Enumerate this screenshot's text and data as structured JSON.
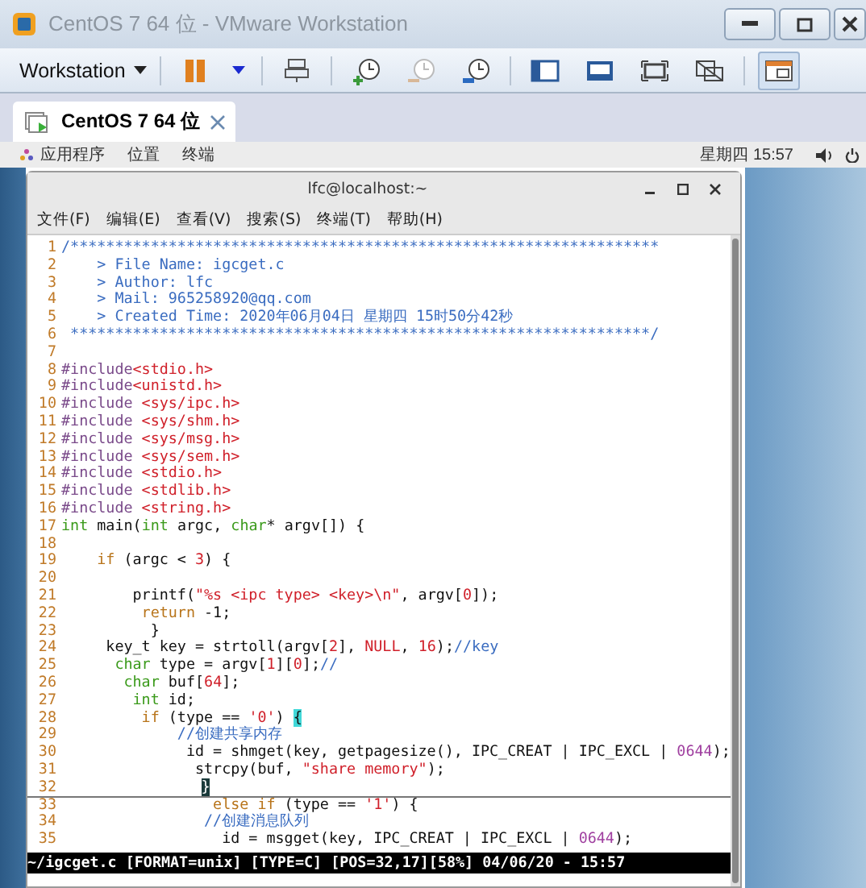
{
  "window": {
    "title": "CentOS 7 64 位 - VMware Workstation"
  },
  "toolbar": {
    "menu_label": "Workstation"
  },
  "tabs": [
    {
      "label": "CentOS 7 64 位",
      "selected": true
    }
  ],
  "guest_top_bar": {
    "menus": [
      "应用程序",
      "位置",
      "终端"
    ],
    "clock": "星期四 15:57"
  },
  "terminal": {
    "title": "lfc@localhost:~",
    "menus": [
      "文件(F)",
      "编辑(E)",
      "查看(V)",
      "搜索(S)",
      "终端(T)",
      "帮助(H)"
    ],
    "lines": [
      {
        "number": "1",
        "current": false,
        "tokens": [
          {
            "kind": "comment",
            "text": "/******************************************************************"
          }
        ]
      },
      {
        "number": "2",
        "current": false,
        "tokens": [
          {
            "kind": "comment",
            "text": "    > File Name: igcget.c"
          }
        ]
      },
      {
        "number": "3",
        "current": false,
        "tokens": [
          {
            "kind": "comment",
            "text": "    > Author: lfc"
          }
        ]
      },
      {
        "number": "4",
        "current": false,
        "tokens": [
          {
            "kind": "comment",
            "text": "    > Mail: 965258920@qq.com"
          }
        ]
      },
      {
        "number": "5",
        "current": false,
        "tokens": [
          {
            "kind": "comment",
            "text": "    > Created Time: 2020年06月04日 星期四 15时50分42秒"
          }
        ]
      },
      {
        "number": "6",
        "current": false,
        "tokens": [
          {
            "kind": "comment",
            "text": " *****************************************************************/"
          }
        ]
      },
      {
        "number": "7",
        "current": false
      },
      {
        "number": "8",
        "current": false,
        "tokens": [
          {
            "kind": "preproc",
            "text": "#include"
          },
          {
            "kind": "header",
            "text": "<stdio.h>"
          }
        ]
      },
      {
        "number": "9",
        "current": false,
        "tokens": [
          {
            "kind": "preproc",
            "text": "#include"
          },
          {
            "kind": "header",
            "text": "<unistd.h>"
          }
        ]
      },
      {
        "number": "10",
        "current": false,
        "tokens": [
          {
            "kind": "preproc",
            "text": "#include "
          },
          {
            "kind": "header",
            "text": "<sys/ipc.h>"
          }
        ]
      },
      {
        "number": "11",
        "current": false,
        "tokens": [
          {
            "kind": "preproc",
            "text": "#include "
          },
          {
            "kind": "header",
            "text": "<sys/shm.h>"
          }
        ]
      },
      {
        "number": "12",
        "current": false,
        "tokens": [
          {
            "kind": "preproc",
            "text": "#include "
          },
          {
            "kind": "header",
            "text": "<sys/msg.h>"
          }
        ]
      },
      {
        "number": "13",
        "current": false,
        "tokens": [
          {
            "kind": "preproc",
            "text": "#include "
          },
          {
            "kind": "header",
            "text": "<sys/sem.h>"
          }
        ]
      },
      {
        "number": "14",
        "current": false,
        "tokens": [
          {
            "kind": "preproc",
            "text": "#include "
          },
          {
            "kind": "header",
            "text": "<stdio.h>"
          }
        ]
      },
      {
        "number": "15",
        "current": false,
        "tokens": [
          {
            "kind": "preproc",
            "text": "#include "
          },
          {
            "kind": "header",
            "text": "<stdlib.h>"
          }
        ]
      },
      {
        "number": "16",
        "current": false,
        "tokens": [
          {
            "kind": "preproc",
            "text": "#include "
          },
          {
            "kind": "header",
            "text": "<string.h>"
          }
        ]
      },
      {
        "number": "17",
        "current": false,
        "tokens": [
          {
            "kind": "type",
            "text": "int"
          },
          {
            "kind": "plain",
            "text": " main("
          },
          {
            "kind": "type",
            "text": "int"
          },
          {
            "kind": "plain",
            "text": " argc, "
          },
          {
            "kind": "type",
            "text": "char"
          },
          {
            "kind": "plain",
            "text": "* argv[]) {"
          }
        ]
      },
      {
        "number": "18",
        "current": false
      },
      {
        "number": "19",
        "current": false,
        "tokens": [
          {
            "kind": "keyword",
            "text": "    if"
          },
          {
            "kind": "plain",
            "text": " (argc < "
          },
          {
            "kind": "number",
            "text": "3"
          },
          {
            "kind": "plain",
            "text": ") {"
          }
        ]
      },
      {
        "number": "20",
        "current": false
      },
      {
        "number": "21",
        "current": false,
        "tokens": [
          {
            "kind": "plain",
            "text": "        printf("
          },
          {
            "kind": "string",
            "text": "\"%s <ipc type> <key>\\n\""
          },
          {
            "kind": "plain",
            "text": ", argv["
          },
          {
            "kind": "number",
            "text": "0"
          },
          {
            "kind": "plain",
            "text": "]);"
          }
        ]
      },
      {
        "number": "22",
        "current": false,
        "tokens": [
          {
            "kind": "keyword",
            "text": "         return"
          },
          {
            "kind": "plain",
            "text": " -1;"
          }
        ]
      },
      {
        "number": "23",
        "current": false,
        "tokens": [
          {
            "kind": "plain",
            "text": "          }"
          }
        ]
      },
      {
        "number": "24",
        "current": false,
        "tokens": [
          {
            "kind": "plain",
            "text": "     key_t key = strtoll(argv["
          },
          {
            "kind": "number",
            "text": "2"
          },
          {
            "kind": "plain",
            "text": "], "
          },
          {
            "kind": "number",
            "text": "NULL"
          },
          {
            "kind": "plain",
            "text": ", "
          },
          {
            "kind": "number",
            "text": "16"
          },
          {
            "kind": "plain",
            "text": ");"
          },
          {
            "kind": "comment",
            "text": "//key"
          }
        ]
      },
      {
        "number": "25",
        "current": false,
        "tokens": [
          {
            "kind": "type",
            "text": "      char"
          },
          {
            "kind": "plain",
            "text": " type = argv["
          },
          {
            "kind": "number",
            "text": "1"
          },
          {
            "kind": "plain",
            "text": "]["
          },
          {
            "kind": "number",
            "text": "0"
          },
          {
            "kind": "plain",
            "text": "];"
          },
          {
            "kind": "comment",
            "text": "//"
          }
        ]
      },
      {
        "number": "26",
        "current": false,
        "tokens": [
          {
            "kind": "type",
            "text": "       char"
          },
          {
            "kind": "plain",
            "text": " buf["
          },
          {
            "kind": "number",
            "text": "64"
          },
          {
            "kind": "plain",
            "text": "];"
          }
        ]
      },
      {
        "number": "27",
        "current": false,
        "tokens": [
          {
            "kind": "type",
            "text": "        int"
          },
          {
            "kind": "plain",
            "text": " id;"
          }
        ]
      },
      {
        "number": "28",
        "current": false,
        "tokens": [
          {
            "kind": "keyword",
            "text": "         if"
          },
          {
            "kind": "plain",
            "text": " (type == "
          },
          {
            "kind": "string",
            "text": "'0'"
          },
          {
            "kind": "plain",
            "text": ") "
          },
          {
            "kind": "match",
            "text": "{"
          }
        ]
      },
      {
        "number": "29",
        "current": false,
        "tokens": [
          {
            "kind": "comment",
            "text": "             //创建共享内存"
          }
        ]
      },
      {
        "number": "30",
        "current": false,
        "tokens": [
          {
            "kind": "plain",
            "text": "              id = shmget(key, getpagesize(), IPC_CREAT | IPC_EXCL | "
          },
          {
            "kind": "octal",
            "text": "0644"
          },
          {
            "kind": "plain",
            "text": ");"
          }
        ]
      },
      {
        "number": "31",
        "current": false,
        "tokens": [
          {
            "kind": "plain",
            "text": "               strcpy(buf, "
          },
          {
            "kind": "string",
            "text": "\"share memory\""
          },
          {
            "kind": "plain",
            "text": ");"
          }
        ]
      },
      {
        "number": "32",
        "current": true,
        "tokens": [
          {
            "kind": "cursor",
            "text": "}"
          }
        ]
      },
      {
        "number": "33",
        "current": false,
        "tokens": [
          {
            "kind": "keyword",
            "text": "                 else if"
          },
          {
            "kind": "plain",
            "text": " (type == "
          },
          {
            "kind": "string",
            "text": "'1'"
          },
          {
            "kind": "plain",
            "text": ") {"
          }
        ]
      },
      {
        "number": "34",
        "current": false,
        "tokens": [
          {
            "kind": "comment",
            "text": "                //创建消息队列"
          }
        ]
      },
      {
        "number": "35",
        "current": false,
        "tokens": [
          {
            "kind": "plain",
            "text": "                  id = msgget(key, IPC_CREAT | IPC_EXCL | "
          },
          {
            "kind": "octal",
            "text": "0644"
          },
          {
            "kind": "plain",
            "text": ");"
          }
        ]
      }
    ],
    "status_line": "~/igcget.c [FORMAT=unix] [TYPE=C] [POS=32,17][58%] 04/06/20 - 15:57"
  }
}
